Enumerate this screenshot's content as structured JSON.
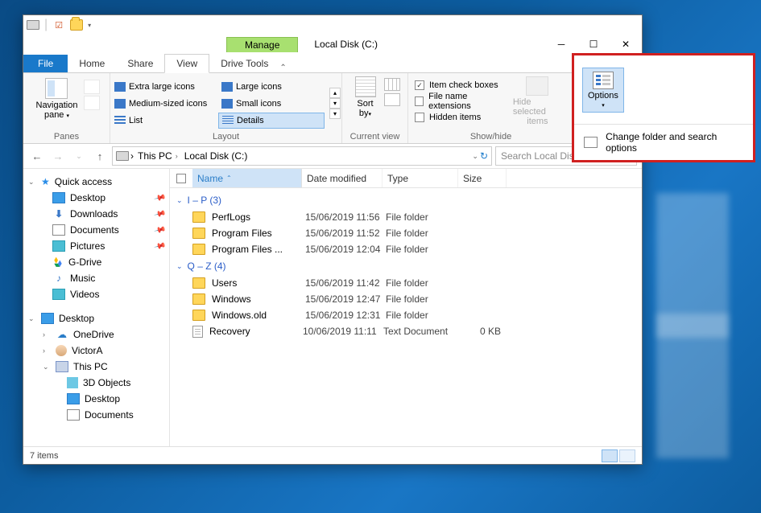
{
  "title": "Local Disk (C:)",
  "manage_tab": "Manage",
  "ribbon_tabs": {
    "file": "File",
    "home": "Home",
    "share": "Share",
    "view": "View",
    "drive_tools": "Drive Tools"
  },
  "ribbon": {
    "panes": {
      "nav": "Navigation",
      "nav2": "pane",
      "group": "Panes"
    },
    "layout": {
      "xl": "Extra large icons",
      "lg": "Large icons",
      "md": "Medium-sized icons",
      "sm": "Small icons",
      "list": "List",
      "details": "Details",
      "group": "Layout"
    },
    "currentview": {
      "sort": "Sort",
      "by": "by",
      "group": "Current view"
    },
    "showhide": {
      "itemcheck": "Item check boxes",
      "ext": "File name extensions",
      "hidden": "Hidden items",
      "hide1": "Hide selected",
      "hide2": "items",
      "group": "Show/hide"
    },
    "options_label": "Options",
    "options_menu": "Change folder and search options"
  },
  "addr": {
    "this_pc": "This PC",
    "drive": "Local Disk (C:)"
  },
  "search_placeholder": "Search Local Disk (C:)",
  "columns": {
    "name": "Name",
    "date": "Date modified",
    "type": "Type",
    "size": "Size"
  },
  "groups": [
    {
      "label": "I – P (3)",
      "items": [
        {
          "name": "PerfLogs",
          "date": "15/06/2019 11:56",
          "type": "File folder",
          "icon": "folder"
        },
        {
          "name": "Program Files",
          "date": "15/06/2019 11:52",
          "type": "File folder",
          "icon": "folder"
        },
        {
          "name": "Program Files ...",
          "date": "15/06/2019 12:04",
          "type": "File folder",
          "icon": "folder"
        }
      ]
    },
    {
      "label": "Q – Z (4)",
      "items": [
        {
          "name": "Users",
          "date": "15/06/2019 11:42",
          "type": "File folder",
          "icon": "folder"
        },
        {
          "name": "Windows",
          "date": "15/06/2019 12:47",
          "type": "File folder",
          "icon": "folder"
        },
        {
          "name": "Windows.old",
          "date": "15/06/2019 12:31",
          "type": "File folder",
          "icon": "folder"
        },
        {
          "name": "Recovery",
          "date": "10/06/2019 11:11",
          "type": "Text Document",
          "size": "0 KB",
          "icon": "file"
        }
      ]
    }
  ],
  "sidebar": {
    "quick": "Quick access",
    "desktop": "Desktop",
    "downloads": "Downloads",
    "documents": "Documents",
    "pictures": "Pictures",
    "gdrive": "G-Drive",
    "music": "Music",
    "videos": "Videos",
    "sec_desktop": "Desktop",
    "onedrive": "OneDrive",
    "user": "VictorA",
    "thispc": "This PC",
    "threed": "3D Objects",
    "desktop2": "Desktop",
    "documents2": "Documents"
  },
  "status": "7 items"
}
